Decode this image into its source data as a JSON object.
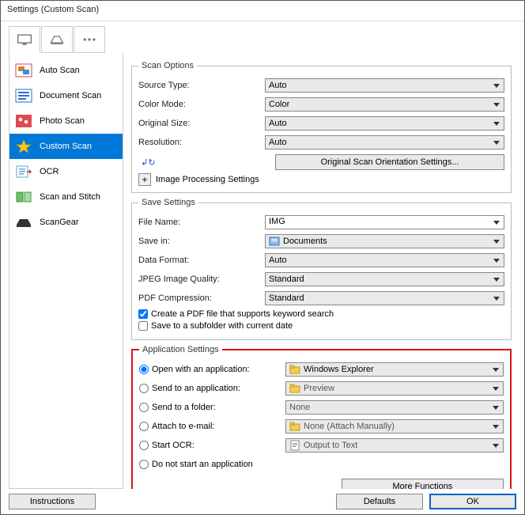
{
  "window": {
    "title": "Settings (Custom Scan)"
  },
  "sidebar": {
    "items": [
      {
        "label": "Auto Scan"
      },
      {
        "label": "Document Scan"
      },
      {
        "label": "Photo Scan"
      },
      {
        "label": "Custom Scan"
      },
      {
        "label": "OCR"
      },
      {
        "label": "Scan and Stitch"
      },
      {
        "label": "ScanGear"
      }
    ]
  },
  "scan_options": {
    "legend": "Scan Options",
    "source_type": {
      "label": "Source Type:",
      "value": "Auto"
    },
    "color_mode": {
      "label": "Color Mode:",
      "value": "Color"
    },
    "original_size": {
      "label": "Original Size:",
      "value": "Auto"
    },
    "resolution": {
      "label": "Resolution:",
      "value": "Auto"
    },
    "orientation_button": "Original Scan Orientation Settings...",
    "image_processing": "Image Processing Settings"
  },
  "save_settings": {
    "legend": "Save Settings",
    "file_name": {
      "label": "File Name:",
      "value": "IMG"
    },
    "save_in": {
      "label": "Save in:",
      "value": "Documents"
    },
    "data_format": {
      "label": "Data Format:",
      "value": "Auto"
    },
    "jpeg_quality": {
      "label": "JPEG Image Quality:",
      "value": "Standard"
    },
    "pdf_compression": {
      "label": "PDF Compression:",
      "value": "Standard"
    },
    "pdf_keyword": "Create a PDF file that supports keyword search",
    "subfolder": "Save to a subfolder with current date"
  },
  "app_settings": {
    "legend": "Application Settings",
    "open_app": {
      "label": "Open with an application:",
      "value": "Windows Explorer"
    },
    "send_app": {
      "label": "Send to an application:",
      "value": "Preview"
    },
    "send_folder": {
      "label": "Send to a folder:",
      "value": "None"
    },
    "attach": {
      "label": "Attach to e-mail:",
      "value": "None (Attach Manually)"
    },
    "ocr": {
      "label": "Start OCR:",
      "value": "Output to Text"
    },
    "dont_start": "Do not start an application",
    "more_functions": "More Functions"
  },
  "footer": {
    "instructions": "Instructions",
    "defaults": "Defaults",
    "ok": "OK"
  }
}
